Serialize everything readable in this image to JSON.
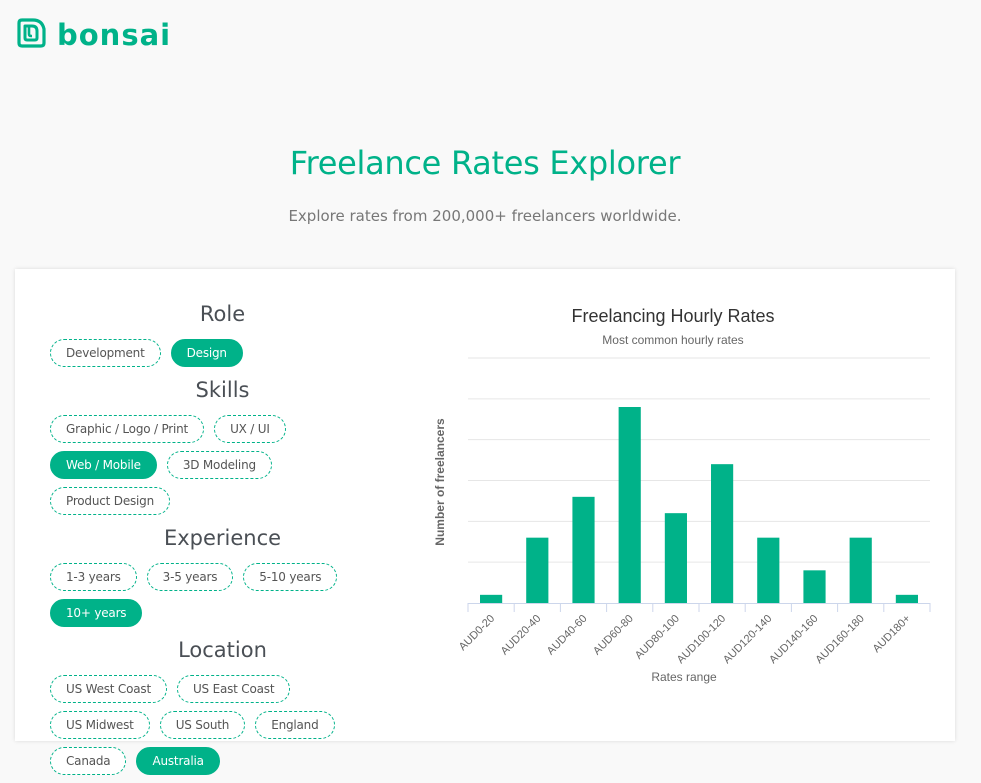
{
  "brand": {
    "name": "bonsai",
    "logo_icon": "bonsai-logo-icon",
    "color": "#00b289"
  },
  "hero": {
    "title": "Freelance Rates Explorer",
    "subtitle": "Explore rates from 200,000+ freelancers worldwide."
  },
  "filters": {
    "groups": [
      {
        "title": "Role",
        "options": [
          {
            "label": "Development",
            "selected": false
          },
          {
            "label": "Design",
            "selected": true
          }
        ]
      },
      {
        "title": "Skills",
        "options": [
          {
            "label": "Graphic / Logo / Print",
            "selected": false
          },
          {
            "label": "UX / UI",
            "selected": false
          },
          {
            "label": "Web / Mobile",
            "selected": true
          },
          {
            "label": "3D Modeling",
            "selected": false
          },
          {
            "label": "Product Design",
            "selected": false
          }
        ]
      },
      {
        "title": "Experience",
        "options": [
          {
            "label": "1-3 years",
            "selected": false
          },
          {
            "label": "3-5 years",
            "selected": false
          },
          {
            "label": "5-10 years",
            "selected": false
          },
          {
            "label": "10+ years",
            "selected": true
          }
        ]
      },
      {
        "title": "Location",
        "options": [
          {
            "label": "US West Coast",
            "selected": false
          },
          {
            "label": "US East Coast",
            "selected": false
          },
          {
            "label": "US Midwest",
            "selected": false
          },
          {
            "label": "US South",
            "selected": false
          },
          {
            "label": "England",
            "selected": false
          },
          {
            "label": "Canada",
            "selected": false
          },
          {
            "label": "Australia",
            "selected": true
          }
        ]
      }
    ]
  },
  "chart_data": {
    "type": "bar",
    "title": "Freelancing Hourly Rates",
    "subtitle": "Most common hourly rates",
    "xlabel": "Rates range",
    "ylabel": "Number of freelancers",
    "categories": [
      "AUD0-20",
      "AUD20-40",
      "AUD40-60",
      "AUD60-80",
      "AUD80-100",
      "AUD100-120",
      "AUD120-140",
      "AUD140-160",
      "AUD160-180",
      "AUD180+"
    ],
    "values": [
      1,
      8,
      13,
      24,
      11,
      17,
      8,
      4,
      8,
      1
    ],
    "ylim": [
      0,
      30
    ],
    "ytick_step": 5,
    "ytick_labels_visible": false,
    "grid": true,
    "legend": "none",
    "bar_color": "#00b289"
  }
}
